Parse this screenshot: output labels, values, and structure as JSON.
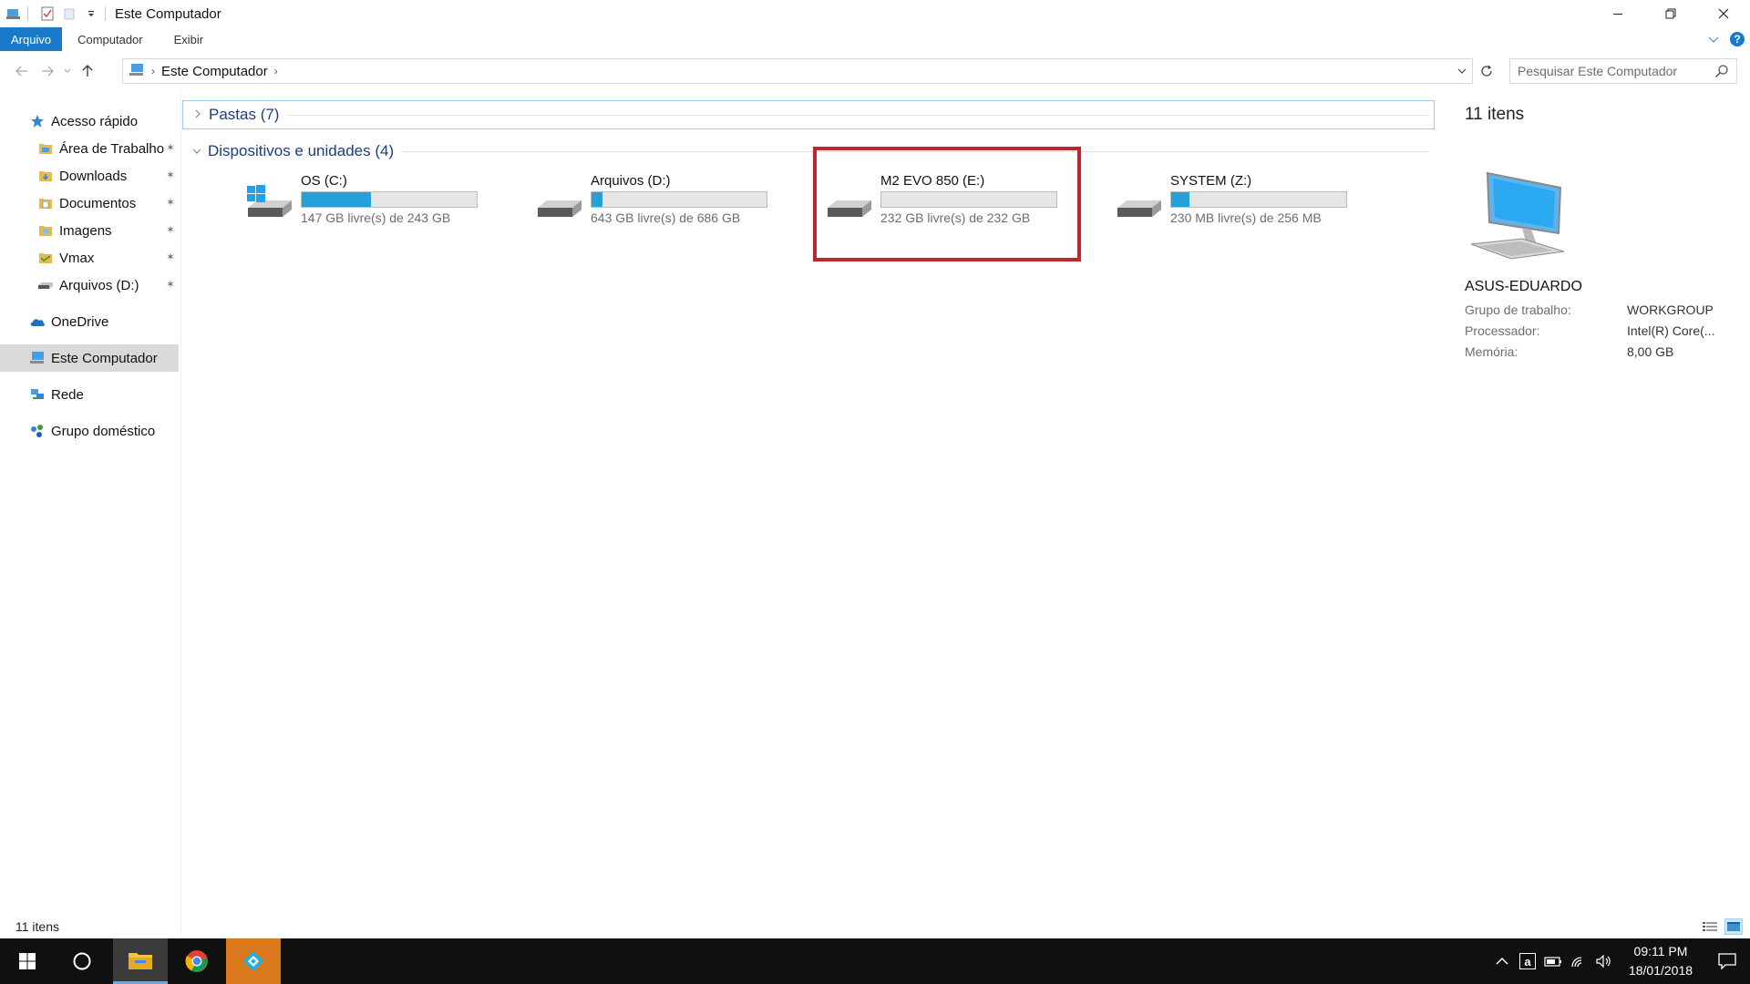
{
  "window": {
    "title": "Este Computador"
  },
  "ribbon": {
    "tabs": [
      {
        "label": "Arquivo"
      },
      {
        "label": "Computador"
      },
      {
        "label": "Exibir"
      }
    ],
    "help_label": "?"
  },
  "address": {
    "crumb": "Este Computador",
    "search_placeholder": "Pesquisar Este Computador"
  },
  "sidebar": {
    "items": [
      {
        "label": "Acesso rápido",
        "icon": "star-icon"
      },
      {
        "label": "Área de Trabalho",
        "icon": "desktop-folder-icon"
      },
      {
        "label": "Downloads",
        "icon": "downloads-folder-icon"
      },
      {
        "label": "Documentos",
        "icon": "documents-folder-icon"
      },
      {
        "label": "Imagens",
        "icon": "pictures-folder-icon"
      },
      {
        "label": "Vmax",
        "icon": "folder-icon"
      },
      {
        "label": "Arquivos (D:)",
        "icon": "drive-icon"
      },
      {
        "label": "OneDrive",
        "icon": "cloud-icon"
      },
      {
        "label": "Este Computador",
        "icon": "computer-icon"
      },
      {
        "label": "Rede",
        "icon": "network-icon"
      },
      {
        "label": "Grupo doméstico",
        "icon": "homegroup-icon"
      }
    ]
  },
  "content": {
    "folders_group": "Pastas (7)",
    "devices_group": "Dispositivos e unidades (4)",
    "drives": [
      {
        "name": "OS (C:)",
        "free": "147 GB livre(s) de 243 GB",
        "used_fraction": 0.395,
        "icon": "windows-drive-icon"
      },
      {
        "name": "Arquivos (D:)",
        "free": "643 GB livre(s) de 686 GB",
        "used_fraction": 0.063,
        "icon": "hard-drive-icon"
      },
      {
        "name": "M2 EVO 850 (E:)",
        "free": "232 GB livre(s) de 232 GB",
        "used_fraction": 0.0,
        "icon": "hard-drive-icon"
      },
      {
        "name": "SYSTEM (Z:)",
        "free": "230 MB livre(s) de 256 MB",
        "used_fraction": 0.102,
        "icon": "hard-drive-icon"
      }
    ]
  },
  "details": {
    "count": "11 itens",
    "computer_name": "ASUS-EDUARDO",
    "rows": [
      {
        "key": "Grupo de trabalho:",
        "value": "WORKGROUP"
      },
      {
        "key": "Processador:",
        "value": "Intel(R) Core(..."
      },
      {
        "key": "Memória:",
        "value": "8,00 GB"
      }
    ]
  },
  "status": {
    "count": "11 itens"
  },
  "taskbar": {
    "time": "09:11 PM",
    "date": "18/01/2018",
    "tray_letter": "a"
  },
  "colors": {
    "accent": "#1979ca",
    "bar_fill": "#26a0da",
    "highlight": "#c0262d",
    "taskbar": "#101010"
  }
}
